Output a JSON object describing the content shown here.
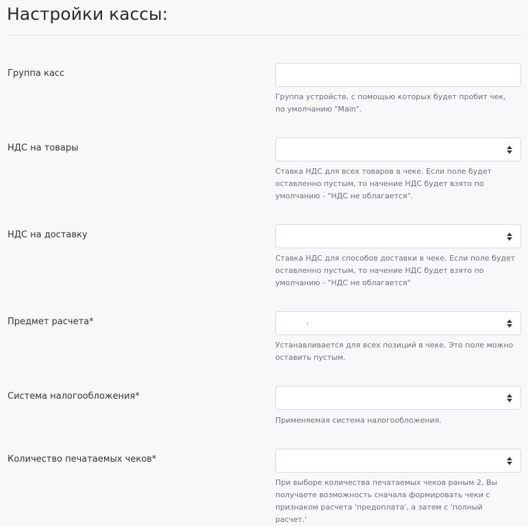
{
  "page": {
    "title": "Настройки кассы:"
  },
  "fields": [
    {
      "label": "Группа касс",
      "type": "text",
      "value": "",
      "help": "Группа устройств, с помощью которых будет пробит чек, по умолчанию \"Main\"."
    },
    {
      "label": "НДС на товары",
      "type": "select",
      "value": "",
      "help": "Ставка НДС для всех товаров в чеке. Если поле будет оставленно пустым, то начение НДС будет взято по умолчанию - \"НДС не облагается\"."
    },
    {
      "label": "НДС на доставку",
      "type": "select",
      "value": "",
      "help": "Ставка НДС для способов доставки в чеке. Если поле будет оставленно пустым, то начение НДС будет взято по умолчанию - \"НДС не облагается\""
    },
    {
      "label": "Предмет расчета*",
      "type": "select",
      "value": "",
      "help": "Устанавливается для всех позиций в чеке. Это поле можно оставить пустым."
    },
    {
      "label": "Система налогообложения*",
      "type": "select",
      "value": "",
      "help": "Применяемая система налогообложения."
    },
    {
      "label": "Количество печатаемых чеков*",
      "type": "select",
      "value": "",
      "help": "При выборе количества печатаемых чеков раным 2, Вы получаете возможность сначала формировать чеки с признаком расчета 'предоплата', а затем с 'полный расчет.'"
    }
  ],
  "icons": {
    "select": "sort-arrows-icon"
  },
  "colors": {
    "background": "#f7f8fa",
    "border": "#d6d9dd",
    "help_text": "#6c7177"
  }
}
